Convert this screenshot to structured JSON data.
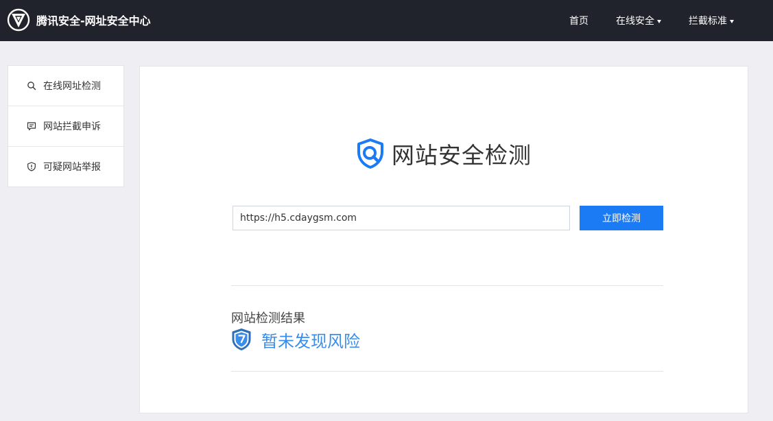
{
  "header": {
    "title": "腾讯安全-网址安全中心",
    "nav": [
      {
        "label": "首页",
        "has_dropdown": false
      },
      {
        "label": "在线安全",
        "has_dropdown": true
      },
      {
        "label": "拦截标准",
        "has_dropdown": true
      }
    ]
  },
  "sidebar": {
    "items": [
      {
        "label": "在线网址检测",
        "icon": "search-icon"
      },
      {
        "label": "网站拦截申诉",
        "icon": "message-icon"
      },
      {
        "label": "可疑网站举报",
        "icon": "shield-alert-icon"
      }
    ]
  },
  "main": {
    "title": "网站安全检测",
    "url_input_value": "https://h5.cdaygsm.com",
    "check_button_label": "立即检测",
    "result_label": "网站检测结果",
    "result_value": "暂未发现风险"
  },
  "colors": {
    "topbar": "#21232c",
    "accent": "#1a7bf5",
    "result_text": "#3a8de8"
  }
}
